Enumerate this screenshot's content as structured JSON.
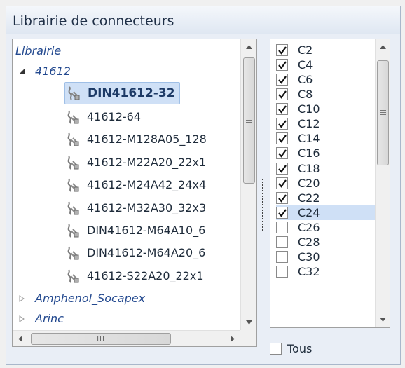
{
  "window": {
    "title": "Librairie de connecteurs"
  },
  "tree": {
    "root_label": "Librairie",
    "groups": [
      {
        "label": "41612",
        "expanded": true,
        "items": [
          {
            "label": "DIN41612-32",
            "selected": true
          },
          {
            "label": "41612-64"
          },
          {
            "label": "41612-M128A05_128"
          },
          {
            "label": "41612-M22A20_22x1"
          },
          {
            "label": "41612-M24A42_24x4"
          },
          {
            "label": "41612-M32A30_32x3"
          },
          {
            "label": "DIN41612-M64A10_6"
          },
          {
            "label": "DIN41612-M64A20_6"
          },
          {
            "label": "41612-S22A20_22x1"
          }
        ]
      },
      {
        "label": "Amphenol_Socapex",
        "expanded": false
      },
      {
        "label": "Arinc",
        "expanded": false
      }
    ],
    "hscroll_grip": "III"
  },
  "contacts": {
    "items": [
      {
        "label": "C2",
        "checked": true
      },
      {
        "label": "C4",
        "checked": true
      },
      {
        "label": "C6",
        "checked": true
      },
      {
        "label": "C8",
        "checked": true
      },
      {
        "label": "C10",
        "checked": true
      },
      {
        "label": "C12",
        "checked": true
      },
      {
        "label": "C14",
        "checked": true
      },
      {
        "label": "C16",
        "checked": true
      },
      {
        "label": "C18",
        "checked": true
      },
      {
        "label": "C20",
        "checked": true
      },
      {
        "label": "C22",
        "checked": true
      },
      {
        "label": "C24",
        "checked": true,
        "highlighted": true
      },
      {
        "label": "C26",
        "checked": false
      },
      {
        "label": "C28",
        "checked": false
      },
      {
        "label": "C30",
        "checked": false
      },
      {
        "label": "C32",
        "checked": false
      }
    ],
    "select_all_label": "Tous",
    "select_all_checked": false
  },
  "colors": {
    "selection": "#cfe0f6",
    "group_text": "#23498f",
    "title_text": "#1f2f46"
  }
}
